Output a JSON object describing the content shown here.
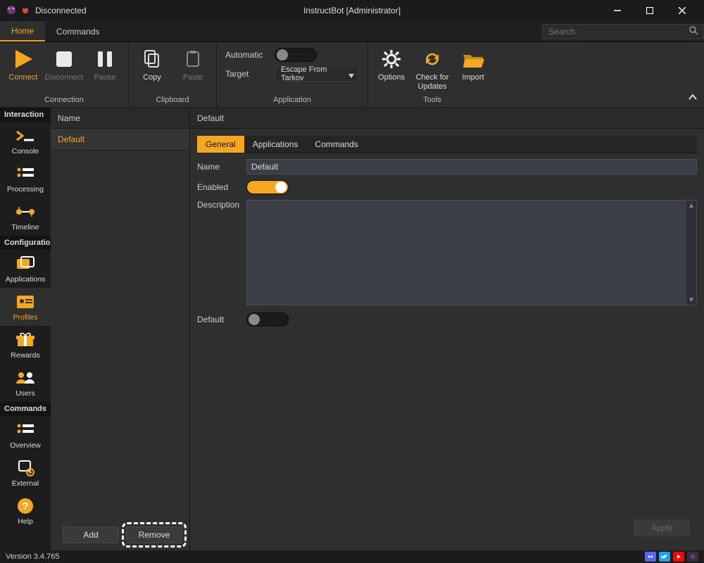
{
  "window": {
    "title": "InstructBot [Administrator]",
    "connection_status": "Disconnected"
  },
  "menu": {
    "tabs": [
      "Home",
      "Commands"
    ],
    "active": "Home",
    "search_placeholder": "Search"
  },
  "ribbon": {
    "groups": {
      "connection": {
        "label": "Connection",
        "connect": "Connect",
        "disconnect": "Disconnect",
        "pause": "Pause"
      },
      "clipboard": {
        "label": "Clipboard",
        "copy": "Copy",
        "paste": "Paste"
      },
      "application": {
        "label": "Application",
        "automatic": "Automatic",
        "target": "Target",
        "target_value": "Escape From Tarkov"
      },
      "tools": {
        "label": "Tools",
        "options": "Options",
        "updates": "Check for\nUpdates",
        "import": "Import"
      }
    }
  },
  "sidebar": {
    "sections": {
      "interaction": {
        "header": "Interaction",
        "items": [
          "Console",
          "Processing",
          "Timeline"
        ]
      },
      "configuration": {
        "header": "Configuration",
        "items": [
          "Applications",
          "Profiles",
          "Rewards",
          "Users"
        ]
      },
      "commands": {
        "header": "Commands",
        "items": [
          "Overview",
          "External",
          "Help"
        ]
      }
    },
    "active": "Profiles"
  },
  "list": {
    "header": "Name",
    "items": [
      "Default"
    ],
    "add": "Add",
    "remove": "Remove"
  },
  "detail": {
    "header": "Default",
    "tabs": [
      "General",
      "Applications",
      "Commands"
    ],
    "active_tab": "General",
    "fields": {
      "name_label": "Name",
      "name_value": "Default",
      "enabled_label": "Enabled",
      "enabled_value": true,
      "description_label": "Description",
      "description_value": "",
      "default_label": "Default",
      "default_value": false
    },
    "apply": "Apply"
  },
  "status": {
    "version": "Version 3.4.765"
  },
  "colors": {
    "accent": "#f5a623"
  }
}
